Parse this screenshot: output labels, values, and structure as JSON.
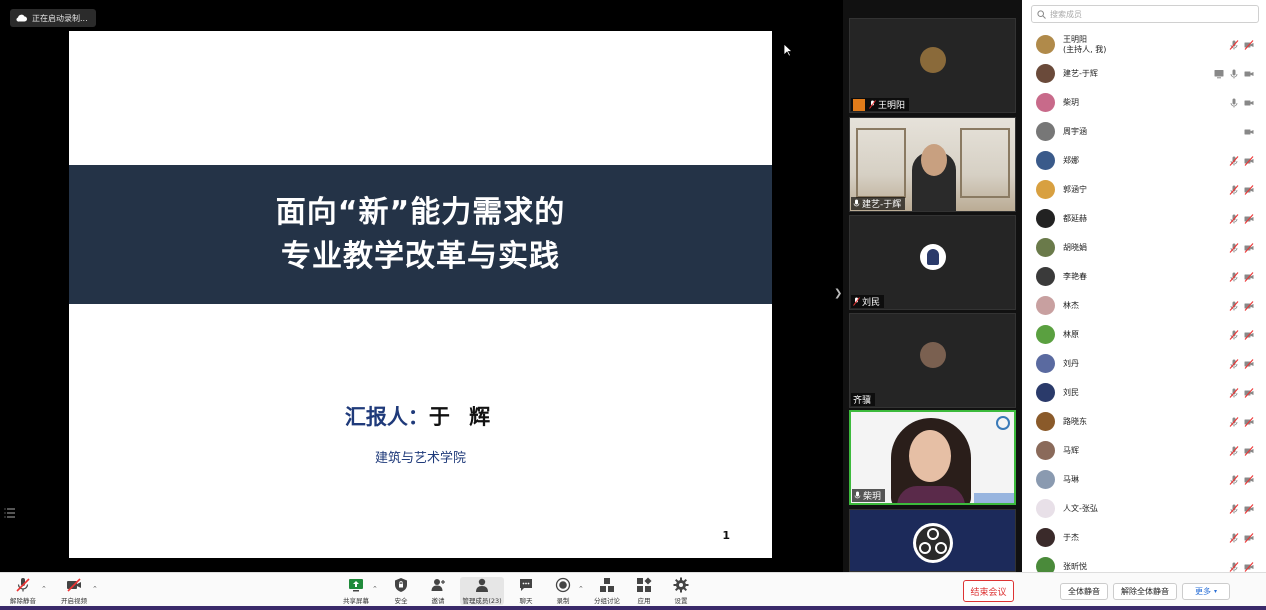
{
  "recording_status": "正在启动录制...",
  "slide": {
    "title_line1": "面向“新”能力需求的",
    "title_line2": "专业教学改革与实践",
    "presenter_label": "汇报人：",
    "presenter_name": "于 辉",
    "college": "建筑与艺术学院",
    "page_number": "1"
  },
  "video_tiles": [
    {
      "name": "王明阳",
      "host": true
    },
    {
      "name": "建艺-于辉",
      "host": false
    },
    {
      "name": "刘民",
      "host": false
    },
    {
      "name": "齐骥",
      "host": false
    },
    {
      "name": "柴玥",
      "host": false
    },
    {
      "name": "",
      "host": false
    }
  ],
  "panel": {
    "search_placeholder": "搜索成员",
    "participants": [
      {
        "name": "王明阳",
        "sub": "(主持人, 我)",
        "screen": false,
        "mic": "muted",
        "cam": "off",
        "color": "#b08a4a"
      },
      {
        "name": "建艺-于辉",
        "sub": "",
        "screen": true,
        "mic": "on",
        "cam": "on",
        "color": "#6a4a3a"
      },
      {
        "name": "柴玥",
        "sub": "",
        "screen": false,
        "mic": "on",
        "cam": "on",
        "color": "#c86a8a"
      },
      {
        "name": "周宇涵",
        "sub": "",
        "screen": false,
        "mic": "none",
        "cam": "on",
        "color": "#777"
      },
      {
        "name": "郑娜",
        "sub": "",
        "screen": false,
        "mic": "muted",
        "cam": "off",
        "color": "#3a5a8a"
      },
      {
        "name": "郭涵宁",
        "sub": "",
        "screen": false,
        "mic": "muted",
        "cam": "off",
        "color": "#d8a040"
      },
      {
        "name": "都延赫",
        "sub": "",
        "screen": false,
        "mic": "muted",
        "cam": "off",
        "color": "#222"
      },
      {
        "name": "胡晓娟",
        "sub": "",
        "screen": false,
        "mic": "muted",
        "cam": "off",
        "color": "#6a7a4a"
      },
      {
        "name": "李艳春",
        "sub": "",
        "screen": false,
        "mic": "muted",
        "cam": "off",
        "color": "#3a3a3a"
      },
      {
        "name": "林杰",
        "sub": "",
        "screen": false,
        "mic": "muted",
        "cam": "off",
        "color": "#c8a0a0"
      },
      {
        "name": "林原",
        "sub": "",
        "screen": false,
        "mic": "muted",
        "cam": "off",
        "color": "#5aa040"
      },
      {
        "name": "刘丹",
        "sub": "",
        "screen": false,
        "mic": "muted",
        "cam": "off",
        "color": "#5a6aa0"
      },
      {
        "name": "刘民",
        "sub": "",
        "screen": false,
        "mic": "muted",
        "cam": "off",
        "color": "#2a3a6a"
      },
      {
        "name": "路晓东",
        "sub": "",
        "screen": false,
        "mic": "muted",
        "cam": "off",
        "color": "#8a5a2a"
      },
      {
        "name": "马辉",
        "sub": "",
        "screen": false,
        "mic": "muted",
        "cam": "off",
        "color": "#8a6a5a"
      },
      {
        "name": "马琳",
        "sub": "",
        "screen": false,
        "mic": "muted",
        "cam": "off",
        "color": "#8a9ab0"
      },
      {
        "name": "人文-张弘",
        "sub": "",
        "screen": false,
        "mic": "muted",
        "cam": "off",
        "color": "#e8e0e8"
      },
      {
        "name": "于杰",
        "sub": "",
        "screen": false,
        "mic": "muted",
        "cam": "off",
        "color": "#3a2a2a"
      },
      {
        "name": "张昕悦",
        "sub": "",
        "screen": false,
        "mic": "muted",
        "cam": "off",
        "color": "#4a8a3a"
      }
    ],
    "mute_all": "全体静音",
    "unmute_all": "解除全体静音",
    "more": "更多"
  },
  "toolbar": {
    "unmute": "解除静音",
    "start_video": "开启视频",
    "share_screen": "共享屏幕",
    "security": "安全",
    "invite": "邀请",
    "manage_members": "管理成员(23)",
    "chat": "聊天",
    "record": "录制",
    "breakout": "分组讨论",
    "apps": "应用",
    "settings": "设置",
    "end_meeting": "结束会议"
  },
  "colors": {
    "slide_band": "#243347",
    "end_red": "#d33333",
    "host_badge": "#e07b1a",
    "speaker_border": "#3cba3c"
  }
}
